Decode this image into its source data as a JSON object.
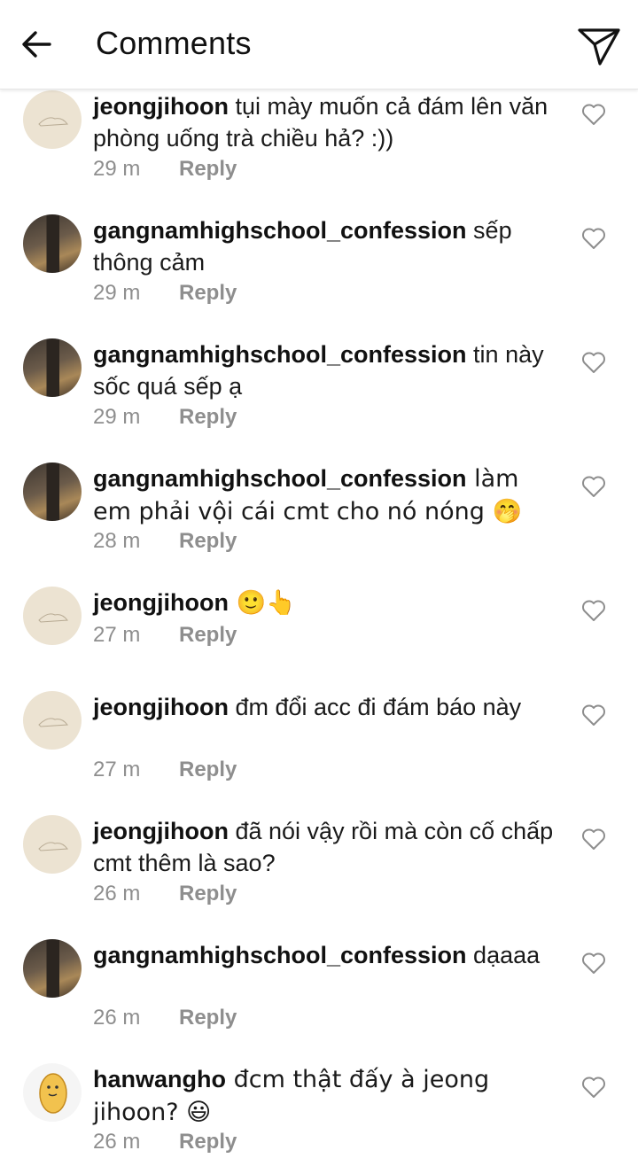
{
  "header": {
    "title": "Comments",
    "back_icon": "arrow-left-icon",
    "send_icon": "paper-plane-icon"
  },
  "colors": {
    "meta_text": "#8e8e8e",
    "text": "#111111",
    "divider": "#e6e6e6"
  },
  "comments": [
    {
      "username": "jeongjihoon",
      "text": " tụi mày muốn cả đám lên văn phòng uống trà chiều hả? :))",
      "time": "29 m",
      "reply": "Reply",
      "avatar": "beige-sketch-avatar"
    },
    {
      "username": "gangnamhighschool_confession",
      "text": " sếp thông cảm",
      "time": "29 m",
      "reply": "Reply",
      "avatar": "room-photo-avatar"
    },
    {
      "username": "gangnamhighschool_confession",
      "text": " tin này sốc quá sếp ạ",
      "time": "29 m",
      "reply": "Reply",
      "avatar": "room-photo-avatar"
    },
    {
      "username": "gangnamhighschool_confession",
      "text": " làm em phải vội cái cmt cho nó nóng 🤭",
      "time": "28 m",
      "reply": "Reply",
      "avatar": "room-photo-avatar"
    },
    {
      "username": "jeongjihoon",
      "text": " 🙂👆",
      "time": "27 m",
      "reply": "Reply",
      "avatar": "beige-sketch-avatar"
    },
    {
      "username": "jeongjihoon",
      "text": " đm đổi acc đi đám báo này",
      "time": "27 m",
      "reply": "Reply",
      "avatar": "beige-sketch-avatar"
    },
    {
      "username": "jeongjihoon",
      "text": " đã nói vậy rồi mà còn cố chấp cmt thêm là sao?",
      "time": "26 m",
      "reply": "Reply",
      "avatar": "beige-sketch-avatar"
    },
    {
      "username": "gangnamhighschool_confession",
      "text": " dạaaa",
      "time": "26 m",
      "reply": "Reply",
      "avatar": "room-photo-avatar"
    },
    {
      "username": "hanwangho",
      "text": " đcm thật đấy à jeong jihoon? 😃",
      "time": "26 m",
      "reply": "Reply",
      "avatar": "potato-cartoon-avatar"
    }
  ]
}
